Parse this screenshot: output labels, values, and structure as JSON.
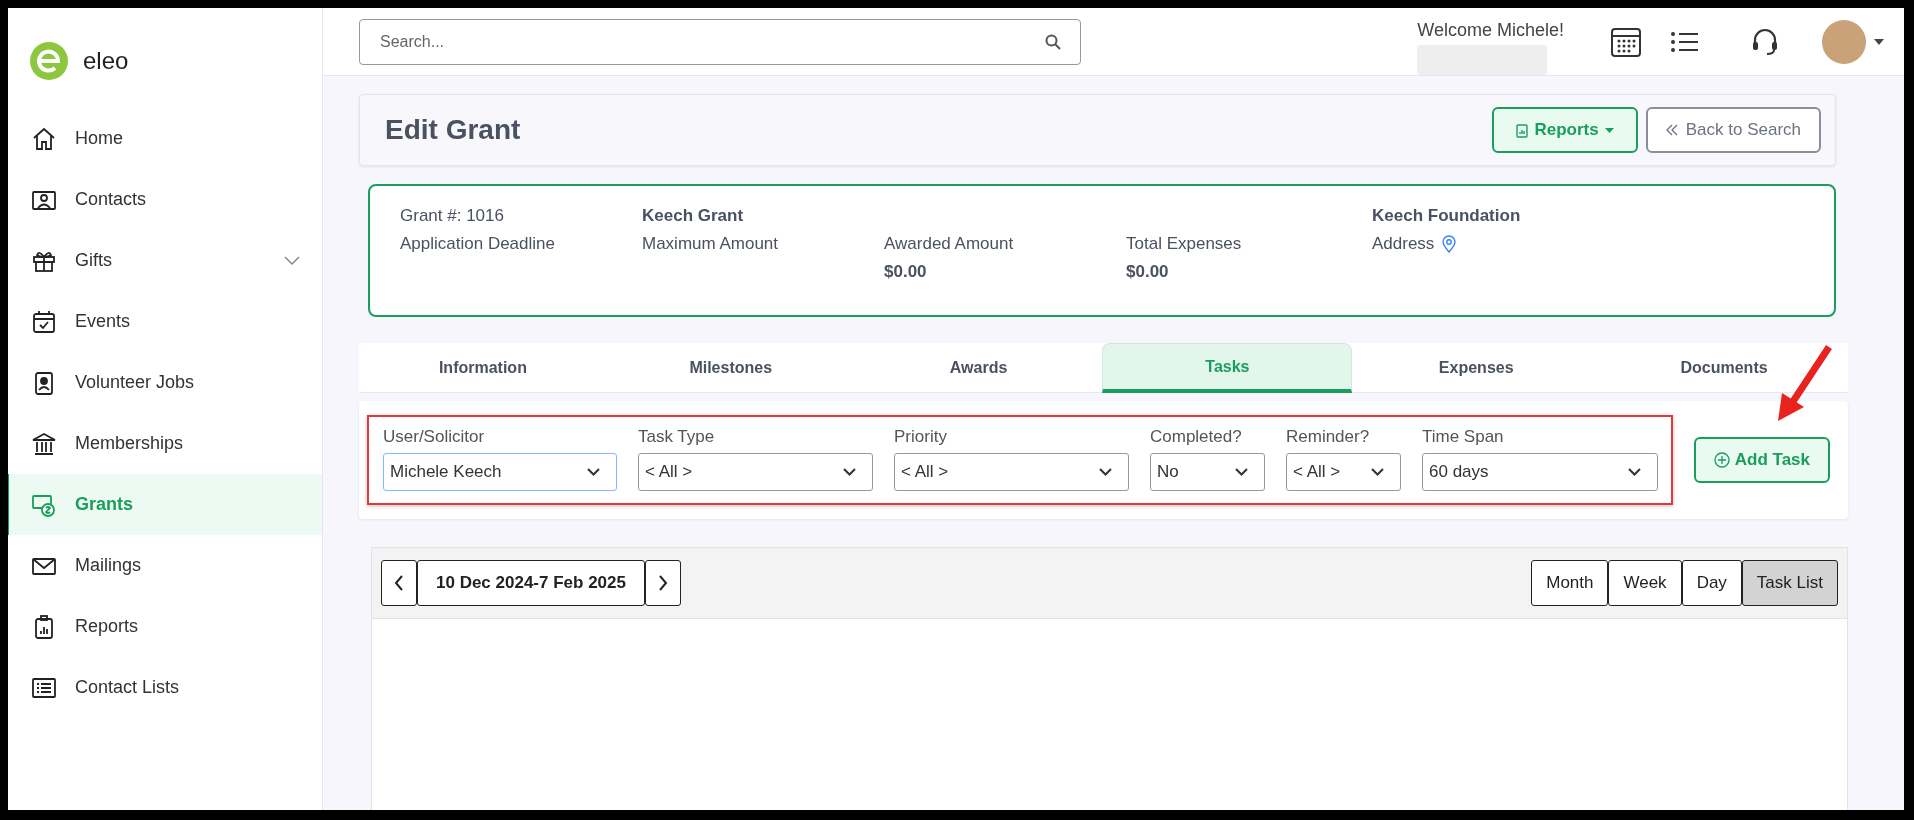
{
  "logo": {
    "text": "eleo"
  },
  "sidebar": {
    "items": [
      {
        "label": "Home",
        "selected": false,
        "has_submenu": false
      },
      {
        "label": "Contacts",
        "selected": false,
        "has_submenu": false
      },
      {
        "label": "Gifts",
        "selected": false,
        "has_submenu": true
      },
      {
        "label": "Events",
        "selected": false,
        "has_submenu": false
      },
      {
        "label": "Volunteer Jobs",
        "selected": false,
        "has_submenu": false
      },
      {
        "label": "Memberships",
        "selected": false,
        "has_submenu": false
      },
      {
        "label": "Grants",
        "selected": true,
        "has_submenu": false
      },
      {
        "label": "Mailings",
        "selected": false,
        "has_submenu": false
      },
      {
        "label": "Reports",
        "selected": false,
        "has_submenu": false
      },
      {
        "label": "Contact Lists",
        "selected": false,
        "has_submenu": false
      }
    ]
  },
  "header": {
    "search": {
      "placeholder": "Search..."
    },
    "welcome": "Welcome Michele!"
  },
  "page": {
    "title": "Edit Grant",
    "reports_button": "Reports",
    "back_button": "Back to Search"
  },
  "grant_card": {
    "columns": [
      {
        "text": "Grant #: 1016",
        "label": "Application Deadline"
      },
      {
        "heading": "Keech Grant",
        "label": "Maximum Amount"
      },
      {
        "label": "Awarded Amount",
        "value": "$0.00"
      },
      {
        "label": "Total Expenses",
        "value": "$0.00"
      },
      {
        "heading": "Keech Foundation",
        "label": "Address",
        "kind": "address"
      }
    ]
  },
  "tabs": [
    {
      "label": "Information",
      "selected": false
    },
    {
      "label": "Milestones",
      "selected": false
    },
    {
      "label": "Awards",
      "selected": false
    },
    {
      "label": "Tasks",
      "selected": true
    },
    {
      "label": "Expenses",
      "selected": false
    },
    {
      "label": "Documents",
      "selected": false
    }
  ],
  "filters": [
    {
      "label": "User/Solicitor",
      "value": "Michele Keech",
      "focused": true
    },
    {
      "label": "Task Type",
      "value": "< All >",
      "focused": false
    },
    {
      "label": "Priority",
      "value": "< All >",
      "focused": false
    },
    {
      "label": "Completed?",
      "value": "No",
      "focused": false
    },
    {
      "label": "Reminder?",
      "value": "< All >",
      "focused": false
    },
    {
      "label": "Time Span",
      "value": "60 days",
      "focused": false
    }
  ],
  "add_task_button": "Add Task",
  "calendar": {
    "range": "10 Dec 2024-7 Feb 2025",
    "views": [
      {
        "label": "Month",
        "selected": false
      },
      {
        "label": "Week",
        "selected": false
      },
      {
        "label": "Day",
        "selected": false
      },
      {
        "label": "Task List",
        "selected": true
      }
    ]
  }
}
